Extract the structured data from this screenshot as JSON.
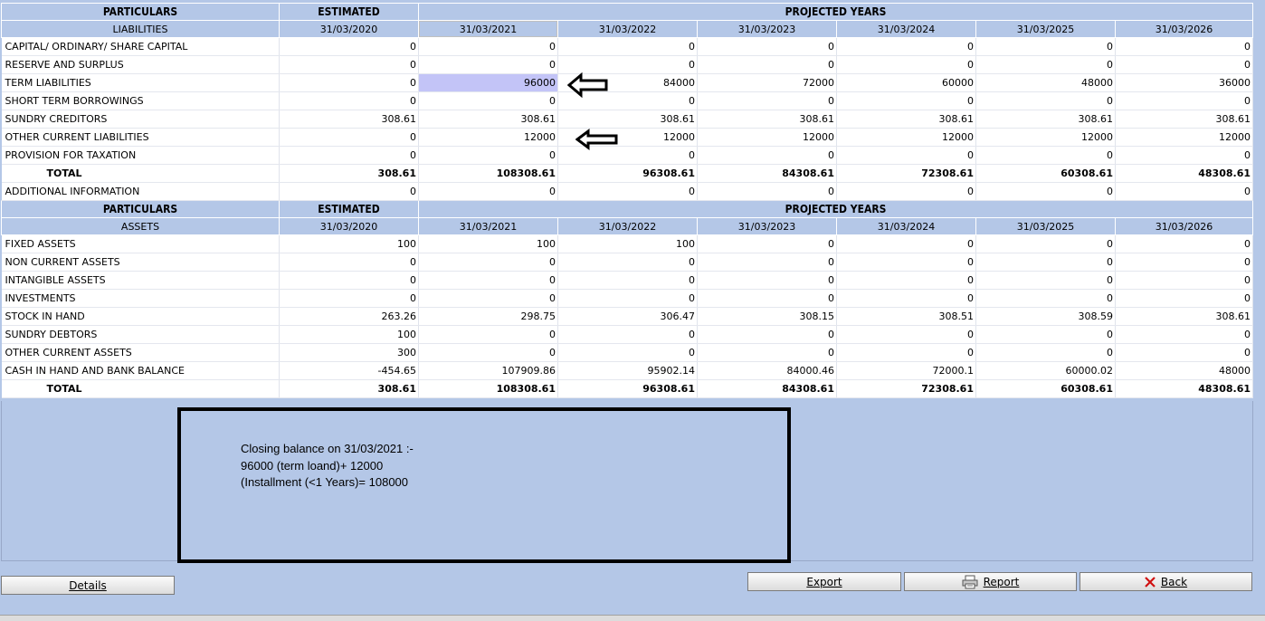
{
  "liabilities": {
    "header": {
      "col1": "PARTICULARS",
      "col2": "ESTIMATED",
      "col3": "PROJECTED YEARS"
    },
    "subheader": {
      "label": "LIABILITIES",
      "dates": [
        "31/03/2020",
        "31/03/2021",
        "31/03/2022",
        "31/03/2023",
        "31/03/2024",
        "31/03/2025",
        "31/03/2026"
      ]
    },
    "rows": [
      {
        "label": "CAPITAL/ ORDINARY/ SHARE CAPITAL",
        "values": [
          "0",
          "0",
          "0",
          "0",
          "0",
          "0",
          "0"
        ]
      },
      {
        "label": "RESERVE AND SURPLUS",
        "values": [
          "0",
          "0",
          "0",
          "0",
          "0",
          "0",
          "0"
        ]
      },
      {
        "label": "TERM LIABILITIES",
        "values": [
          "0",
          "96000",
          "84000",
          "72000",
          "60000",
          "48000",
          "36000"
        ]
      },
      {
        "label": "SHORT TERM BORROWINGS",
        "values": [
          "0",
          "0",
          "0",
          "0",
          "0",
          "0",
          "0"
        ]
      },
      {
        "label": "SUNDRY CREDITORS",
        "values": [
          "308.61",
          "308.61",
          "308.61",
          "308.61",
          "308.61",
          "308.61",
          "308.61"
        ]
      },
      {
        "label": "OTHER CURRENT LIABILITIES",
        "values": [
          "0",
          "12000",
          "12000",
          "12000",
          "12000",
          "12000",
          "12000"
        ]
      },
      {
        "label": "PROVISION FOR TAXATION",
        "values": [
          "0",
          "0",
          "0",
          "0",
          "0",
          "0",
          "0"
        ]
      }
    ],
    "total": {
      "label": "TOTAL",
      "values": [
        "308.61",
        "108308.61",
        "96308.61",
        "84308.61",
        "72308.61",
        "60308.61",
        "48308.61"
      ]
    },
    "additional": {
      "label": "ADDITIONAL INFORMATION",
      "values": [
        "0",
        "0",
        "0",
        "0",
        "0",
        "0",
        "0"
      ]
    }
  },
  "assets": {
    "header": {
      "col1": "PARTICULARS",
      "col2": "ESTIMATED",
      "col3": "PROJECTED YEARS"
    },
    "subheader": {
      "label": "ASSETS",
      "dates": [
        "31/03/2020",
        "31/03/2021",
        "31/03/2022",
        "31/03/2023",
        "31/03/2024",
        "31/03/2025",
        "31/03/2026"
      ]
    },
    "rows": [
      {
        "label": "FIXED ASSETS",
        "values": [
          "100",
          "100",
          "100",
          "0",
          "0",
          "0",
          "0"
        ]
      },
      {
        "label": "NON CURRENT ASSETS",
        "values": [
          "0",
          "0",
          "0",
          "0",
          "0",
          "0",
          "0"
        ]
      },
      {
        "label": "INTANGIBLE ASSETS",
        "values": [
          "0",
          "0",
          "0",
          "0",
          "0",
          "0",
          "0"
        ]
      },
      {
        "label": "INVESTMENTS",
        "values": [
          "0",
          "0",
          "0",
          "0",
          "0",
          "0",
          "0"
        ]
      },
      {
        "label": "STOCK IN HAND",
        "values": [
          "263.26",
          "298.75",
          "306.47",
          "308.15",
          "308.51",
          "308.59",
          "308.61"
        ]
      },
      {
        "label": "SUNDRY DEBTORS",
        "values": [
          "100",
          "0",
          "0",
          "0",
          "0",
          "0",
          "0"
        ]
      },
      {
        "label": "OTHER CURRENT ASSETS",
        "values": [
          "300",
          "0",
          "0",
          "0",
          "0",
          "0",
          "0"
        ]
      },
      {
        "label": "CASH IN HAND AND BANK BALANCE",
        "values": [
          "-454.65",
          "107909.86",
          "95902.14",
          "84000.46",
          "72000.1",
          "60000.02",
          "48000"
        ]
      }
    ],
    "total": {
      "label": "TOTAL",
      "values": [
        "308.61",
        "108308.61",
        "96308.61",
        "84308.61",
        "72308.61",
        "60308.61",
        "48308.61"
      ]
    }
  },
  "note": {
    "line1": "Closing balance on 31/03/2021 :-",
    "line2": "96000 (term loand)+ 12000",
    "line3": "(Installment (<1 Years)= 108000"
  },
  "buttons": {
    "details": "Details",
    "export": "Export",
    "report": "Report",
    "back": "Back"
  },
  "icons": {
    "report": "printer-icon",
    "back": "close-x-icon",
    "arrow": "left-arrow-icon"
  },
  "colors": {
    "header_bg": "#b4c7e7",
    "selected_cell": "#c3c4f7",
    "back_x": "#d01010"
  }
}
